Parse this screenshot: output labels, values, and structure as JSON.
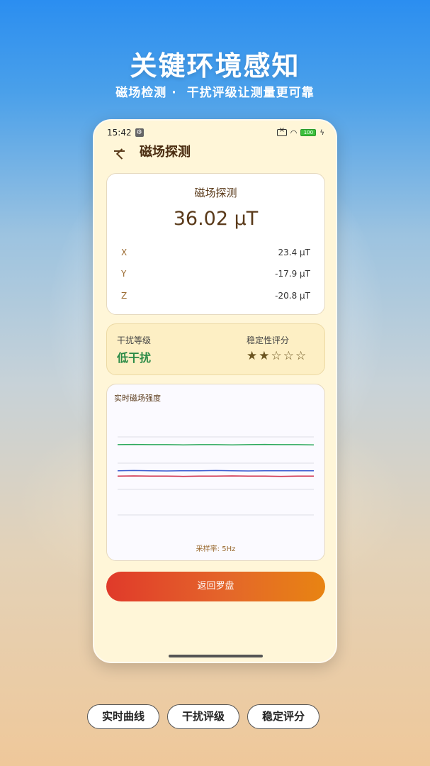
{
  "promo": {
    "headline": "关键环境感知",
    "sub_left": "磁场检测 ·",
    "sub_right": "干扰评级让测量更可靠"
  },
  "status_bar": {
    "time": "15:42",
    "battery": "100"
  },
  "app": {
    "title": "磁场探测",
    "magnetic": {
      "title": "磁场探测",
      "value": "36.02 μT",
      "axes": [
        {
          "label": "X",
          "value": "23.4 μT"
        },
        {
          "label": "Y",
          "value": "-17.9 μT"
        },
        {
          "label": "Z",
          "value": "-20.8 μT"
        }
      ]
    },
    "interference": {
      "label": "干扰等级",
      "value": "低干扰",
      "stability_label": "稳定性评分",
      "stars": "★★☆☆☆",
      "rating": 2,
      "rating_max": 5,
      "value_color": "#2a8a45"
    },
    "chart": {
      "title": "实时磁场强度",
      "sample_rate": "采样率: 5Hz"
    },
    "return_button": "返回罗盘"
  },
  "chips": [
    "实时曲线",
    "干扰评级",
    "稳定评分"
  ],
  "colors": {
    "accent_start": "#e03a2a",
    "accent_end": "#e88412",
    "line_green": "#2aa85a",
    "line_blue": "#3a5bd0",
    "line_red": "#d0304a"
  },
  "chart_data": {
    "type": "line",
    "title": "",
    "xlabel": "",
    "ylabel": "",
    "grid": true,
    "series": [
      {
        "color": "#2aa85a",
        "values": [
          36.0,
          36.1,
          36.0,
          36.0,
          35.9,
          36.0,
          36.0,
          35.9,
          36.0,
          36.1,
          36.0,
          36.0,
          35.9
        ]
      },
      {
        "color": "#3a5bd0",
        "values": [
          23.4,
          23.5,
          23.4,
          23.3,
          23.4,
          23.4,
          23.5,
          23.4,
          23.3,
          23.4,
          23.4,
          23.4,
          23.4
        ]
      },
      {
        "color": "#d0304a",
        "values": [
          20.8,
          20.9,
          20.8,
          20.8,
          20.7,
          20.8,
          20.8,
          20.9,
          20.8,
          20.8,
          20.7,
          20.8,
          20.8
        ]
      }
    ],
    "ylim": [
      0,
      50
    ]
  }
}
